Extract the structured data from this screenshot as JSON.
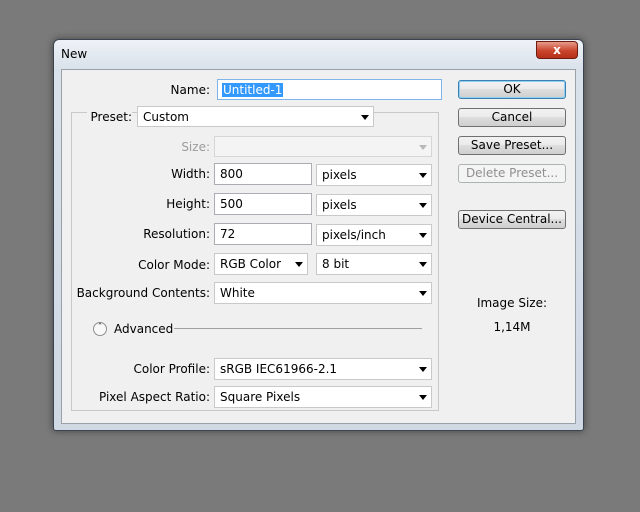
{
  "dialog": {
    "title": "New",
    "close_symbol": "x"
  },
  "form": {
    "name_label": "Name:",
    "name_value": "Untitled-1",
    "preset_label": "Preset:",
    "preset_value": "Custom",
    "size_label": "Size:",
    "size_value": "",
    "width_label": "Width:",
    "width_value": "800",
    "width_unit": "pixels",
    "height_label": "Height:",
    "height_value": "500",
    "height_unit": "pixels",
    "resolution_label": "Resolution:",
    "resolution_value": "72",
    "resolution_unit": "pixels/inch",
    "color_mode_label": "Color Mode:",
    "color_mode_value": "RGB Color",
    "bit_depth_value": "8 bit",
    "background_label": "Background Contents:",
    "background_value": "White",
    "advanced_label": "Advanced",
    "color_profile_label": "Color Profile:",
    "color_profile_value": "sRGB IEC61966-2.1",
    "pixel_aspect_label": "Pixel Aspect Ratio:",
    "pixel_aspect_value": "Square Pixels"
  },
  "buttons": {
    "ok": "OK",
    "cancel": "Cancel",
    "save_preset": "Save Preset...",
    "delete_preset": "Delete Preset...",
    "device_central": "Device Central..."
  },
  "image_size": {
    "label": "Image Size:",
    "value": "1,14M"
  },
  "icons": {
    "close": "close-icon",
    "dropdown": "chevron-down-icon",
    "advanced_toggle": "chevron-up-double-icon"
  },
  "colors": {
    "desktop": "#7a7a7a",
    "selection": "#3399ff",
    "close_button": "#c9452c"
  }
}
